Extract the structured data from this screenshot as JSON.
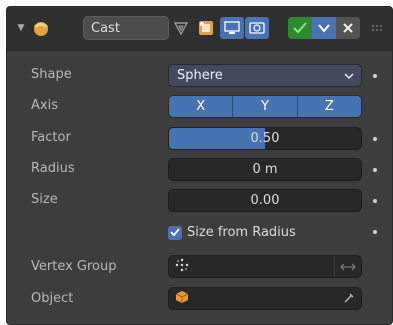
{
  "header": {
    "name": "Cast"
  },
  "rows": {
    "shape": {
      "label": "Shape",
      "value": "Sphere"
    },
    "axis": {
      "label": "Axis",
      "options": [
        "X",
        "Y",
        "Z"
      ]
    },
    "factor": {
      "label": "Factor",
      "value": "0.50",
      "fill": 0.5
    },
    "radius": {
      "label": "Radius",
      "value": "0 m"
    },
    "size": {
      "label": "Size",
      "value": "0.00"
    },
    "size_from_radius": {
      "label": "Size from Radius",
      "checked": true
    },
    "vertex_group": {
      "label": "Vertex Group",
      "value": ""
    },
    "object": {
      "label": "Object",
      "value": ""
    }
  },
  "colors": {
    "accent": "#4772b3",
    "panel_bg": "#3d3d3d",
    "field_bg": "#282828",
    "check_green": "#2e8a2e"
  }
}
